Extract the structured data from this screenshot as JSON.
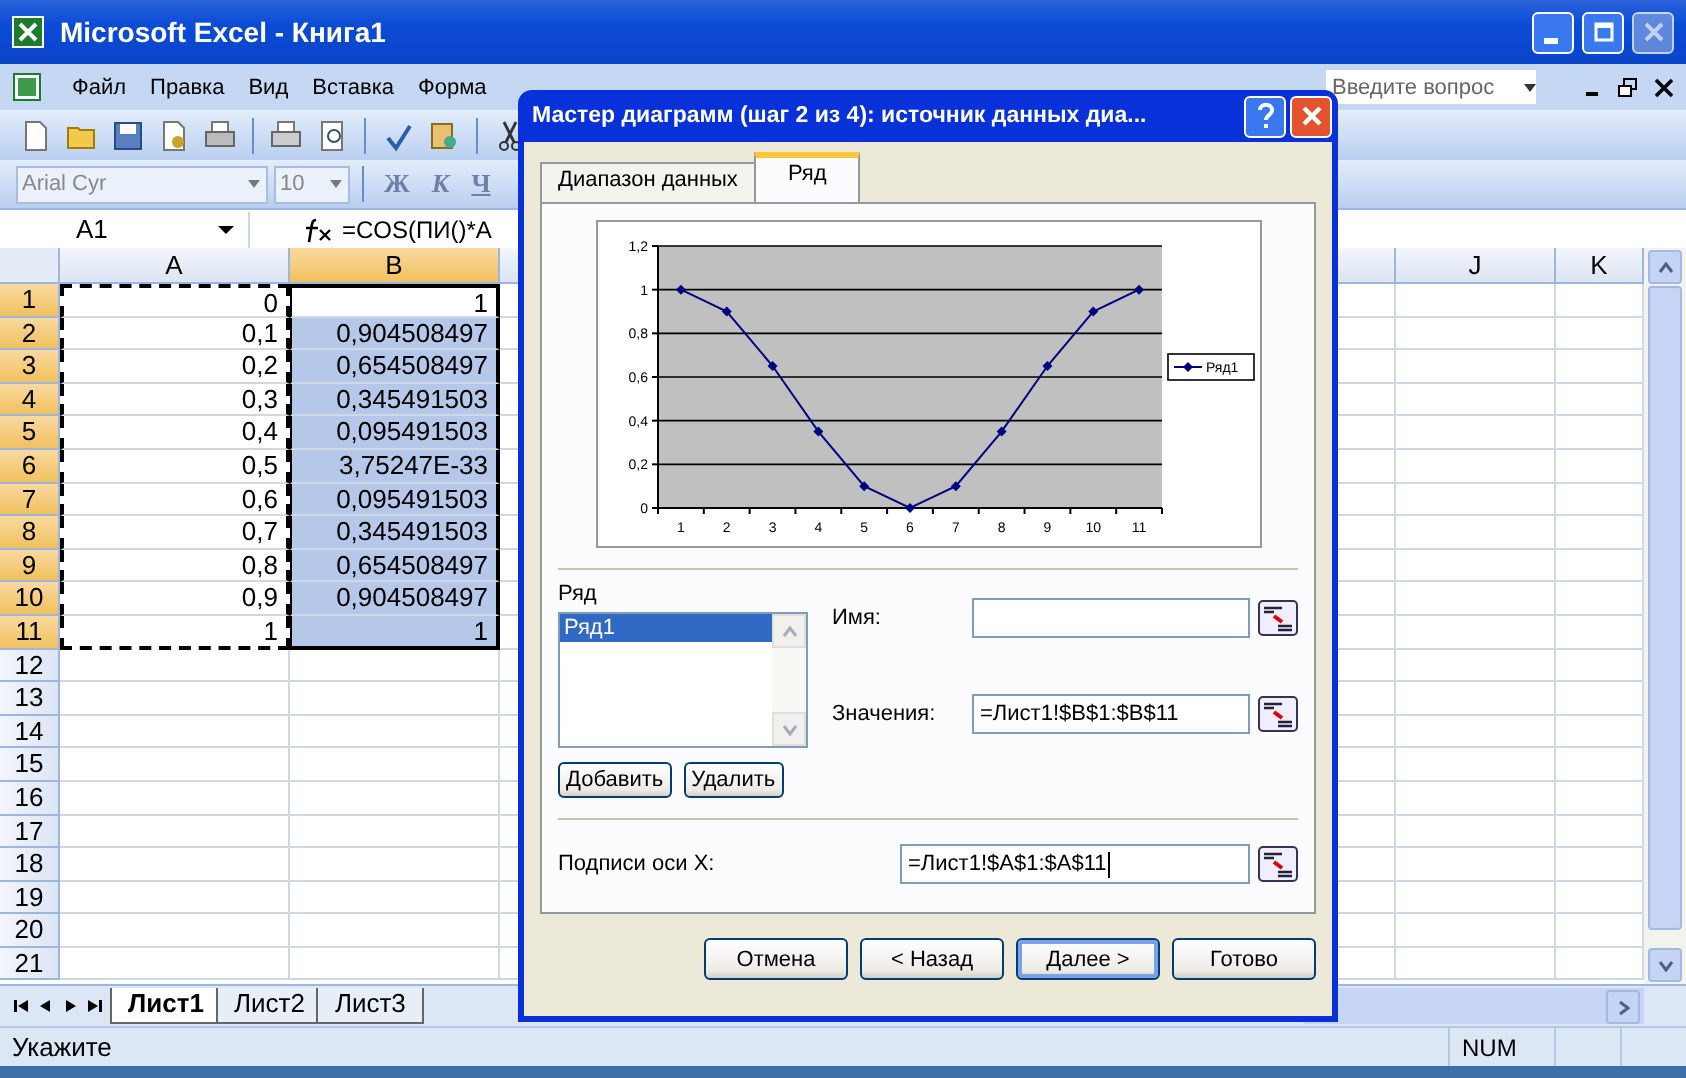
{
  "window": {
    "title": "Microsoft Excel - Книга1"
  },
  "menu": [
    "Файл",
    "Правка",
    "Вид",
    "Вставка",
    "Форма"
  ],
  "help_search": {
    "placeholder": "Введите вопрос"
  },
  "format_toolbar": {
    "font": "Arial Cyr",
    "size": "10",
    "buttons": [
      "Ж",
      "К",
      "Ч"
    ]
  },
  "formula_bar": {
    "name_box": "A1",
    "formula": "=COS(ПИ()*A"
  },
  "sheet": {
    "columns": [
      {
        "label": "A",
        "selected": false
      },
      {
        "label": "B",
        "selected": true
      },
      {
        "selected": false
      },
      {
        "label": "J",
        "selected": false
      },
      {
        "label": "K",
        "selected": false
      }
    ],
    "rows": [
      {
        "number": "1",
        "selected": true,
        "cells": [
          "0",
          "1"
        ]
      },
      {
        "number": "2",
        "selected": true,
        "cells": [
          "0,1",
          "0,904508497"
        ]
      },
      {
        "number": "3",
        "selected": true,
        "cells": [
          "0,2",
          "0,654508497"
        ]
      },
      {
        "number": "4",
        "selected": true,
        "cells": [
          "0,3",
          "0,345491503"
        ]
      },
      {
        "number": "5",
        "selected": true,
        "cells": [
          "0,4",
          "0,095491503"
        ]
      },
      {
        "number": "6",
        "selected": true,
        "cells": [
          "0,5",
          "3,75247E-33"
        ]
      },
      {
        "number": "7",
        "selected": true,
        "cells": [
          "0,6",
          "0,095491503"
        ]
      },
      {
        "number": "8",
        "selected": true,
        "cells": [
          "0,7",
          "0,345491503"
        ]
      },
      {
        "number": "9",
        "selected": true,
        "cells": [
          "0,8",
          "0,654508497"
        ]
      },
      {
        "number": "10",
        "selected": true,
        "cells": [
          "0,9",
          "0,904508497"
        ]
      },
      {
        "number": "11",
        "selected": true,
        "cells": [
          "1",
          "1"
        ]
      },
      {
        "number": "12",
        "selected": false,
        "cells": []
      },
      {
        "number": "13",
        "selected": false,
        "cells": []
      },
      {
        "number": "14",
        "selected": false,
        "cells": []
      },
      {
        "number": "15",
        "selected": false,
        "cells": []
      },
      {
        "number": "16",
        "selected": false,
        "cells": []
      },
      {
        "number": "17",
        "selected": false,
        "cells": []
      },
      {
        "number": "18",
        "selected": false,
        "cells": []
      },
      {
        "number": "19",
        "selected": false,
        "cells": []
      },
      {
        "number": "20",
        "selected": false,
        "cells": []
      },
      {
        "number": "21",
        "selected": false,
        "cells": []
      }
    ]
  },
  "sheet_tabs": [
    {
      "label": "Лист1",
      "selected": true
    },
    {
      "label": "Лист2",
      "selected": false
    },
    {
      "label": "Лист3",
      "selected": false
    }
  ],
  "status_bar": {
    "text": "Укажите",
    "indicator": "NUM"
  },
  "dialog": {
    "title": "Мастер диаграмм (шаг 2 из 4): источник данных диа...",
    "tabs": [
      {
        "label": "Диапазон данных",
        "selected": false
      },
      {
        "label": "Ряд",
        "selected": true
      }
    ],
    "chart_data": {
      "type": "line",
      "grid": true,
      "categories": [
        "1",
        "2",
        "3",
        "4",
        "5",
        "6",
        "7",
        "8",
        "9",
        "10",
        "11"
      ],
      "series": [
        {
          "name": "Ряд1",
          "color": "#000080",
          "marker": "diamond",
          "values": [
            1,
            0.9,
            0.65,
            0.35,
            0.1,
            0,
            0.1,
            0.35,
            0.65,
            0.9,
            1
          ]
        }
      ],
      "ylim": [
        0,
        1.2
      ],
      "yticks": [
        {
          "value": 0,
          "label": "0"
        },
        {
          "value": 0.2,
          "label": "0,2"
        },
        {
          "value": 0.4,
          "label": "0,4"
        },
        {
          "value": 0.6,
          "label": "0,6"
        },
        {
          "value": 0.8,
          "label": "0,8"
        },
        {
          "value": 1,
          "label": "1"
        },
        {
          "value": 1.2,
          "label": "1,2"
        }
      ]
    },
    "series_label": "Ряд",
    "series_list": [
      {
        "label": "Ряд1",
        "selected": true
      }
    ],
    "name_field": {
      "label": "Имя:"
    },
    "values_field": {
      "label": "Значения:",
      "value": "=Лист1!$B$1:$B$11"
    },
    "add_button": "Добавить",
    "remove_button": "Удалить",
    "x_labels_field": {
      "label": "Подписи оси X:",
      "value": "=Лист1!$A$1:$A$11"
    },
    "buttons": [
      {
        "label": "Отмена",
        "default": false
      },
      {
        "label": "< Назад",
        "default": false
      },
      {
        "label": "Далее >",
        "default": true
      },
      {
        "label": "Готово",
        "default": false
      }
    ]
  }
}
